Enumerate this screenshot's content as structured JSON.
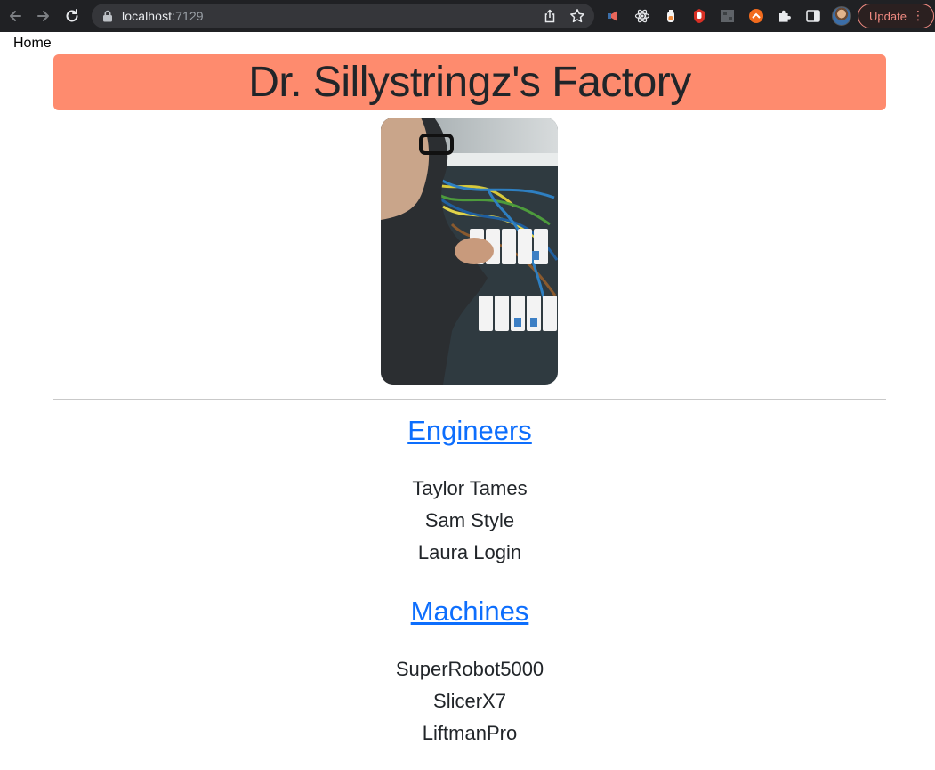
{
  "browser": {
    "url_host": "localhost",
    "url_port": ":7129",
    "update_label": "Update",
    "accent": "#f28b82"
  },
  "nav": {
    "home_label": "Home"
  },
  "header": {
    "title": "Dr. Sillystringz's Factory",
    "background": "#fe8b6e"
  },
  "hero_image": {
    "icon": "electrician-photo"
  },
  "engineers": {
    "title": "Engineers",
    "items": [
      "Taylor Tames",
      "Sam Style",
      "Laura Login"
    ]
  },
  "machines": {
    "title": "Machines",
    "items": [
      "SuperRobot5000",
      "SlicerX7",
      "LiftmanPro"
    ]
  },
  "colors": {
    "link": "#0d6efd",
    "text": "#212529"
  }
}
